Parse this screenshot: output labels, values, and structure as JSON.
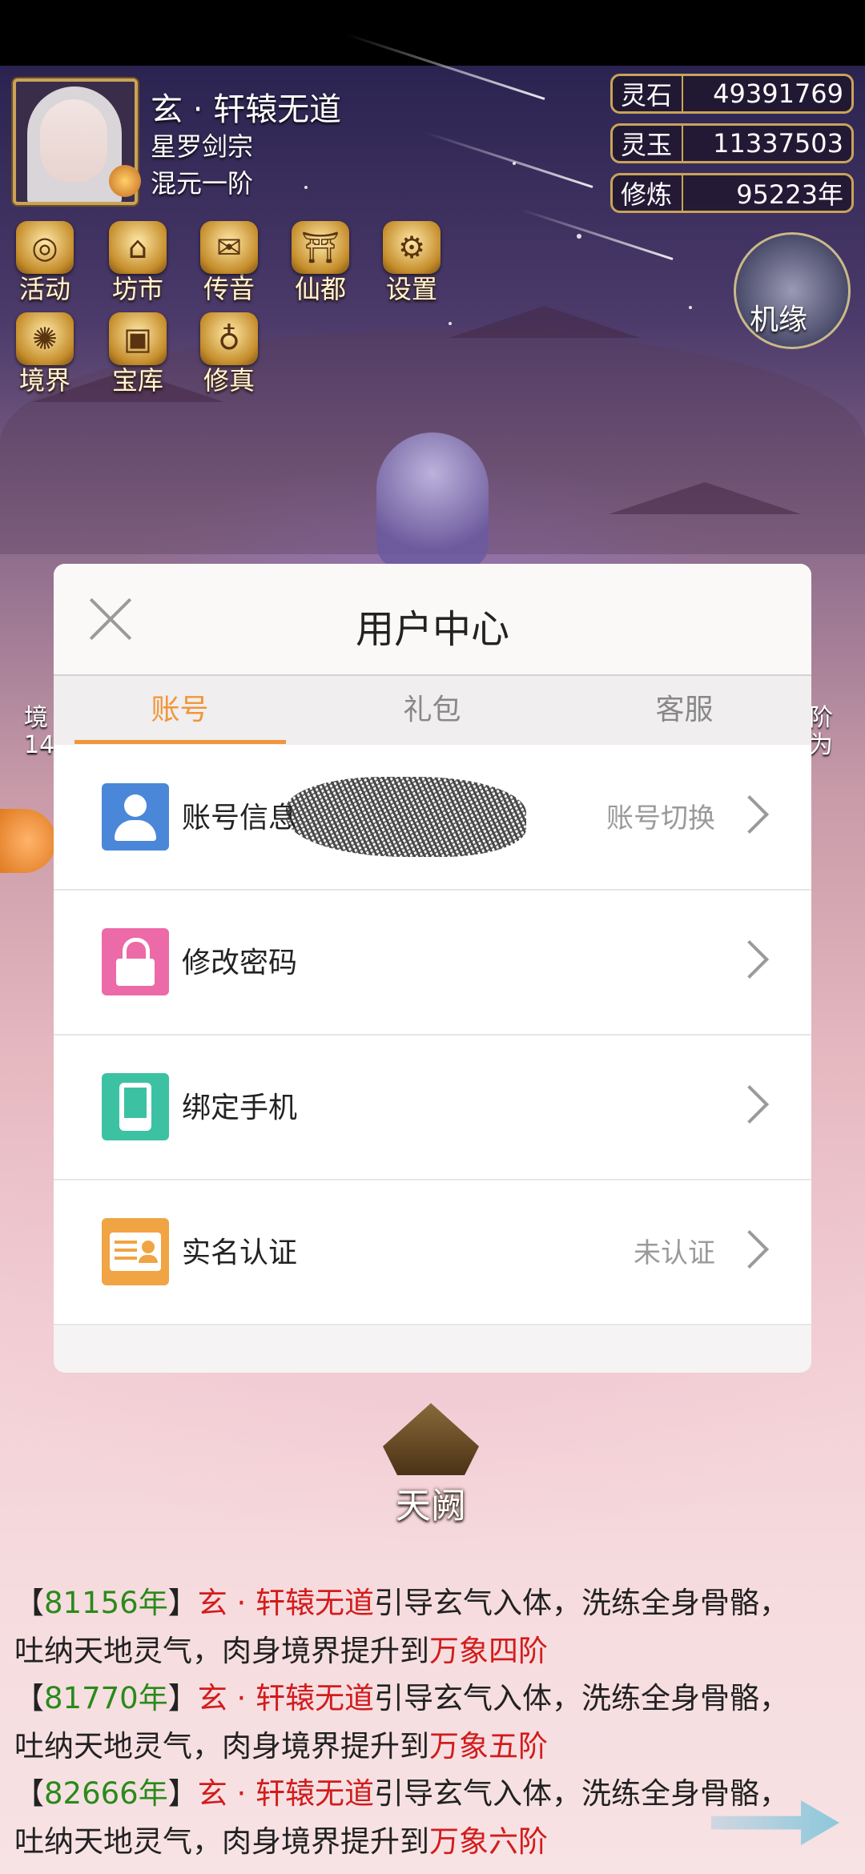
{
  "player": {
    "name": "玄 · 轩辕无道",
    "sect": "星罗剑宗",
    "rank": "混元一阶"
  },
  "resources": [
    {
      "name": "灵石",
      "value": "49391769"
    },
    {
      "name": "灵玉",
      "value": "11337503"
    },
    {
      "name": "修炼",
      "value": "95223年"
    }
  ],
  "menu": {
    "row1": [
      {
        "label": "活动",
        "icon": "coin-icon"
      },
      {
        "label": "坊市",
        "icon": "market-icon"
      },
      {
        "label": "传音",
        "icon": "envelope-icon"
      },
      {
        "label": "仙都",
        "icon": "city-icon"
      },
      {
        "label": "设置",
        "icon": "gear-icon"
      }
    ],
    "row2": [
      {
        "label": "境界",
        "icon": "realm-icon"
      },
      {
        "label": "宝库",
        "icon": "treasure-icon"
      },
      {
        "label": "修真",
        "icon": "pouch-icon"
      }
    ],
    "jiyuan": "机缘"
  },
  "side": {
    "left": "境\n14",
    "right": "阶\n为"
  },
  "dialog": {
    "title": "用户中心",
    "tabs": [
      "账号",
      "礼包",
      "客服"
    ],
    "active_tab": "账号",
    "rows": [
      {
        "label": "账号信息",
        "value": "账号切换",
        "icon": "user-icon"
      },
      {
        "label": "修改密码",
        "value": "",
        "icon": "lock-icon"
      },
      {
        "label": "绑定手机",
        "value": "",
        "icon": "phone-icon"
      },
      {
        "label": "实名认证",
        "value": "未认证",
        "icon": "id-card-icon"
      }
    ]
  },
  "tianque": "天阙",
  "log": [
    {
      "year": "81156年",
      "name": "玄 · 轩辕无道",
      "text1": "引导玄气入体，洗练全身骨骼，",
      "text2": "吐纳天地灵气，肉身境界提升到",
      "realm": "万象四阶"
    },
    {
      "year": "81770年",
      "name": "玄 · 轩辕无道",
      "text1": "引导玄气入体，洗练全身骨骼，",
      "text2": "吐纳天地灵气，肉身境界提升到",
      "realm": "万象五阶"
    },
    {
      "year": "82666年",
      "name": "玄 · 轩辕无道",
      "text1": "引导玄气入体，洗练全身骨骼，",
      "text2": "吐纳天地灵气，肉身境界提升到",
      "realm": "万象六阶"
    }
  ],
  "colors": {
    "accent": "#f0963a",
    "log_year": "#2a8a1a",
    "log_highlight": "#d21c1c",
    "frame_gold": "#c9a35a"
  }
}
